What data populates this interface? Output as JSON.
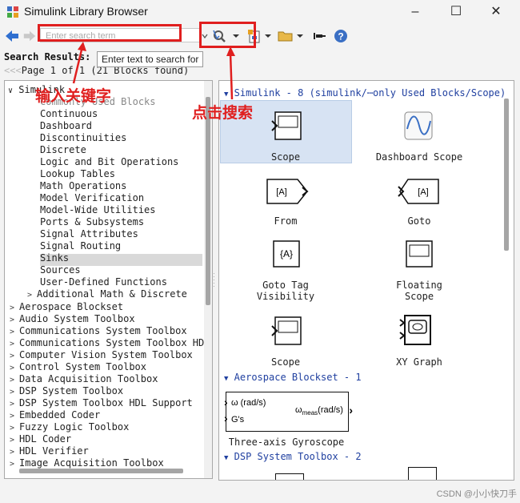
{
  "window": {
    "title": "Simulink Library Browser",
    "minimize": "–",
    "maximize": "☐",
    "close": "✕"
  },
  "toolbar": {
    "search_placeholder": "Enter search term"
  },
  "tooltip": "Enter text to search for",
  "results": {
    "title": "Search Results: sc",
    "pager": "Page 1 of 1 (21 Blocks found)"
  },
  "tree": {
    "root": "Simulink",
    "hidden_first_child": "Commonly Used Blocks",
    "children": [
      "Continuous",
      "Dashboard",
      "Discontinuities",
      "Discrete",
      "Logic and Bit Operations",
      "Lookup Tables",
      "Math Operations",
      "Model Verification",
      "Model-Wide Utilities",
      "Ports & Subsystems",
      "Signal Attributes",
      "Signal Routing",
      "Sinks",
      "Sources",
      "User-Defined Functions",
      "Additional Math & Discrete"
    ],
    "selected": "Sinks",
    "toolboxes": [
      "Aerospace Blockset",
      "Audio System Toolbox",
      "Communications System Toolbox",
      "Communications System Toolbox HDL",
      "Computer Vision System Toolbox",
      "Control System Toolbox",
      "Data Acquisition Toolbox",
      "DSP System Toolbox",
      "DSP System Toolbox HDL Support",
      "Embedded Coder",
      "Fuzzy Logic Toolbox",
      "HDL Coder",
      "HDL Verifier",
      "Image Acquisition Toolbox"
    ]
  },
  "blocks": {
    "sections": [
      "Simulink - 8 (simulink/⋯only Used Blocks/Scope)",
      "Aerospace Blockset - 1",
      "DSP System Toolbox - 2"
    ],
    "items": [
      "Scope",
      "Dashboard Scope",
      "From",
      "Goto",
      "Goto Tag\nVisibility",
      "Floating\nScope",
      "Scope",
      "XY Graph",
      "Three-axis Gyroscope"
    ],
    "from_tag": "[A]",
    "goto_tag": "[A]",
    "gototag_tag": "{A}",
    "gyro": {
      "in1": "ω (rad/s)",
      "in2": "G's",
      "out": "ω",
      "out_sub": "meas",
      "out_unit": "(rad/s)"
    }
  },
  "annotations": {
    "keyword": "输入关键字",
    "search": "点击搜索"
  },
  "watermark": "CSDN @小小快刀手",
  "colors": {
    "annotation": "#e01f1f",
    "section": "#2040a0",
    "selection": "#d7e3f3"
  }
}
